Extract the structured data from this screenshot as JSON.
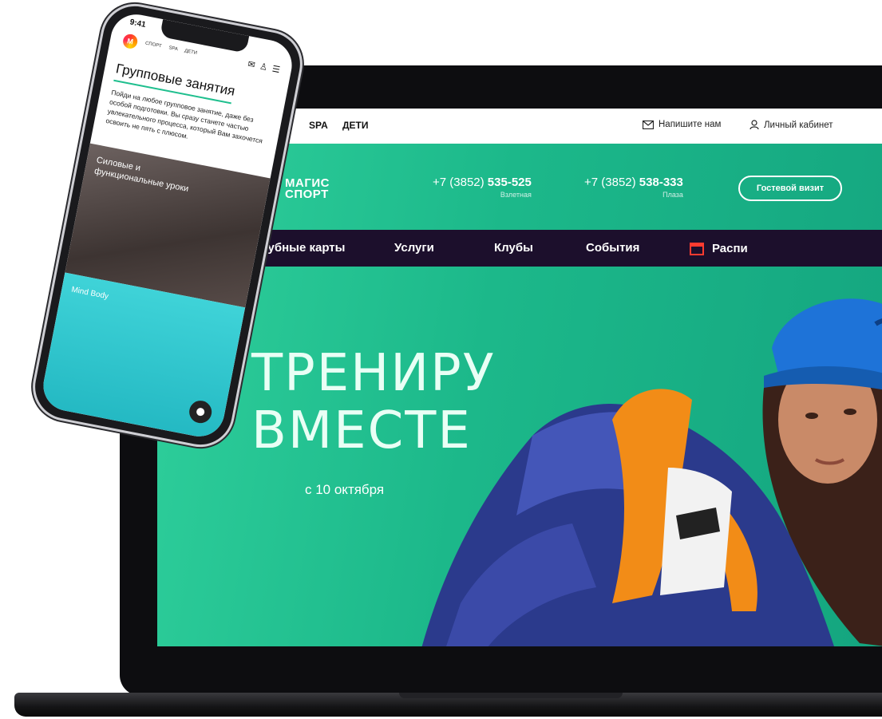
{
  "laptop": {
    "topbar": {
      "links": [
        "SPA",
        "ДЕТИ"
      ],
      "write_us": "Напишите нам",
      "account": "Личный кабинет"
    },
    "brand": {
      "line1": "МАГИС",
      "line2": "СПОРТ",
      "mark": "M"
    },
    "phones": [
      {
        "prefix": "+7 (3852) ",
        "number": "535-525",
        "location": "Взлетная"
      },
      {
        "prefix": "+7 (3852) ",
        "number": "538-333",
        "location": "Плаза"
      }
    ],
    "guest_button": "Гостевой визит",
    "nav": [
      "Клубные карты",
      "Услуги",
      "Клубы",
      "События",
      "Распи"
    ],
    "hero": {
      "line1": "ТРЕНИРУ",
      "line2": "ВМЕСТЕ",
      "date": "с 10 октября"
    }
  },
  "phone": {
    "time": "9:41",
    "brand_mark": "M",
    "top_links": [
      "СПОРТ",
      "SPA",
      "ДЕТИ"
    ],
    "heading": "Групповые занятия",
    "description": "Пойди на любое групповое занятие, даже без особой подготовки. Вы сразу станете частью увлекательного процесса, который Вам захочется освоить не пять с плюсом.",
    "card1_title": "Силовые и функциональные уроки",
    "card2_title": "Mind Body"
  },
  "colors": {
    "hero_green": "#1cb88a",
    "nav_purple": "#1c0f2c",
    "accent_red": "#ff3b30",
    "phone_cyan": "#2cc3cc"
  }
}
